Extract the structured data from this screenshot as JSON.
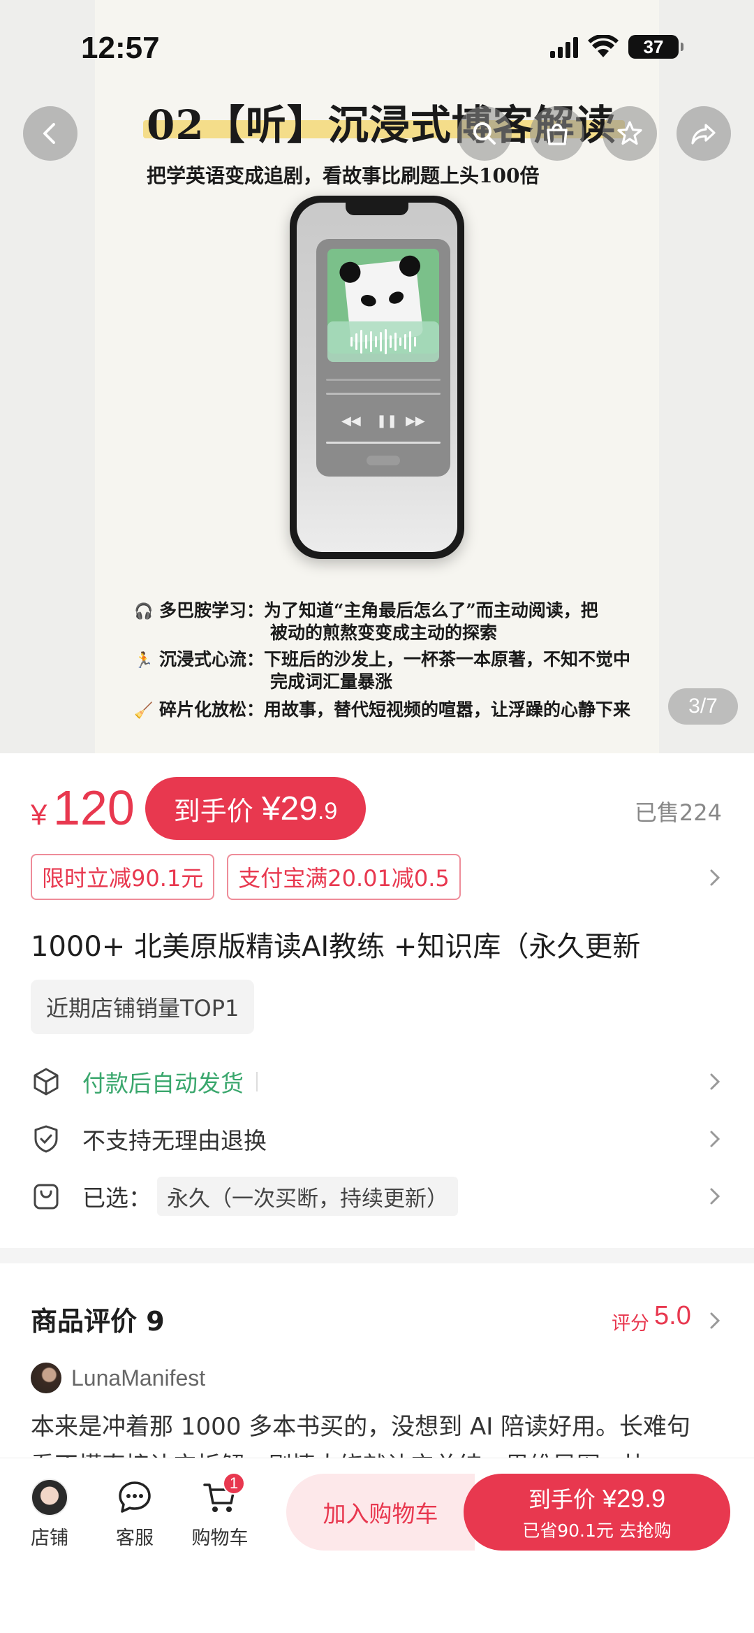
{
  "status_bar": {
    "time": "12:57",
    "battery": "37"
  },
  "hero": {
    "title": "02【听】沉浸式博客解读",
    "subtitle": "把学英语变成追剧，看故事比刷题上头100倍",
    "features": [
      {
        "icon": "🎧",
        "label": "多巴胺学习：",
        "text": "为了知道“主角最后怎么了”而主动阅读，把",
        "cont": "被动的煎熬变变成主动的探索"
      },
      {
        "icon": "🏃",
        "label": "沉浸式心流：",
        "text": "下班后的沙发上，一杯茶一本原著，不知不觉中",
        "cont": "完成词汇量暴涨"
      },
      {
        "icon": "🧹",
        "label": "碎片化放松：",
        "text": "用故事，替代短视频的喧嚣，让浮躁的心静下来",
        "cont": ""
      }
    ],
    "page_indicator": "3/7"
  },
  "price": {
    "yen": "¥",
    "value": "120",
    "deal_label": "到手价",
    "deal_yen": "¥",
    "deal_int": "29",
    "deal_dec": ".9",
    "sold": "已售224"
  },
  "coupons": [
    "限时立减90.1元",
    "支付宝满20.01减0.5"
  ],
  "product_title": "1000+ 北美原版精读AI教练 +知识库（永久更新",
  "rank_tag": "近期店铺销量TOP1",
  "services": {
    "delivery": "付款后自动发货",
    "return_policy": "不支持无理由退换",
    "selected_label": "已选：",
    "selected_value": "永久（一次买断，持续更新）"
  },
  "reviews": {
    "heading": "商品评价 9",
    "score_label": "评分",
    "score": "5.0",
    "user": "LunaManifest",
    "text_line1": "本来是冲着那 1000 多本书买的，没想到 AI 陪读好用。长难句",
    "text_line2": "看不懂直接让它拆解，剧情太绕就让它总结，思维导图，比"
  },
  "bottom_bar": {
    "store": "店铺",
    "service": "客服",
    "cart": "购物车",
    "cart_count": "1",
    "add_to_cart": "加入购物车",
    "buy_label": "到手价",
    "buy_price": "¥29.9",
    "buy_sub": "已省90.1元 去抢购"
  },
  "colors": {
    "accent": "#e8384f",
    "green": "#3aa76d"
  }
}
